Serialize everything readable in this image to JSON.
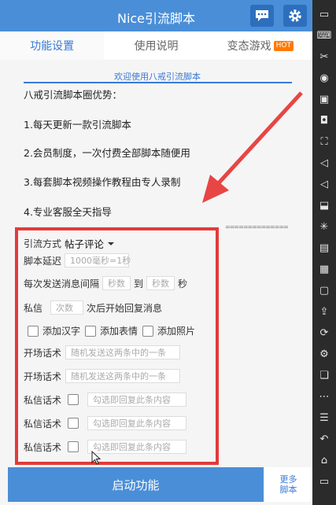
{
  "app": {
    "title": "Nice引流脚本"
  },
  "tabs": [
    {
      "label": "功能设置"
    },
    {
      "label": "使用说明"
    },
    {
      "label": "变态游戏",
      "badge": "HOT"
    }
  ],
  "welcome": "欢迎使用八戒引流脚本",
  "advantages": {
    "heading": "八戒引流脚本圈优势：",
    "items": [
      "1.每天更新一款引流脚本",
      "2.会员制度，一次付费全部脚本随便用",
      "3.每套脚本视频操作教程由专人录制",
      "4.专业客服全天指导"
    ],
    "separator": "=============="
  },
  "form": {
    "mode_label": "引流方式",
    "mode_value": "帖子评论",
    "delay_label": "脚本延迟",
    "delay_placeholder": "1000毫秒=1秒",
    "interval_label": "每次发送消息间隔",
    "interval_from_placeholder": "秒数",
    "interval_to": "到",
    "interval_to_placeholder": "秒数",
    "interval_unit": "秒",
    "dm_label": "私信",
    "dm_placeholder": "次数",
    "dm_suffix": "次后开始回复消息",
    "add_chars": "添加汉字",
    "add_emoji": "添加表情",
    "add_photo": "添加照片",
    "opening_label": "开场话术",
    "opening_placeholder": "随机发送这两条中的一条",
    "private_label": "私信话术",
    "private_placeholder": "勾选即回复此条内容"
  },
  "bottom": {
    "start": "启动功能",
    "more_line1": "更多",
    "more_line2": "脚本"
  },
  "colors": {
    "primary": "#4a8ed8",
    "accent": "#3a7ad5",
    "highlight_border": "#e33a3a",
    "arrow": "#e84545",
    "hot": "#ff7a00"
  }
}
